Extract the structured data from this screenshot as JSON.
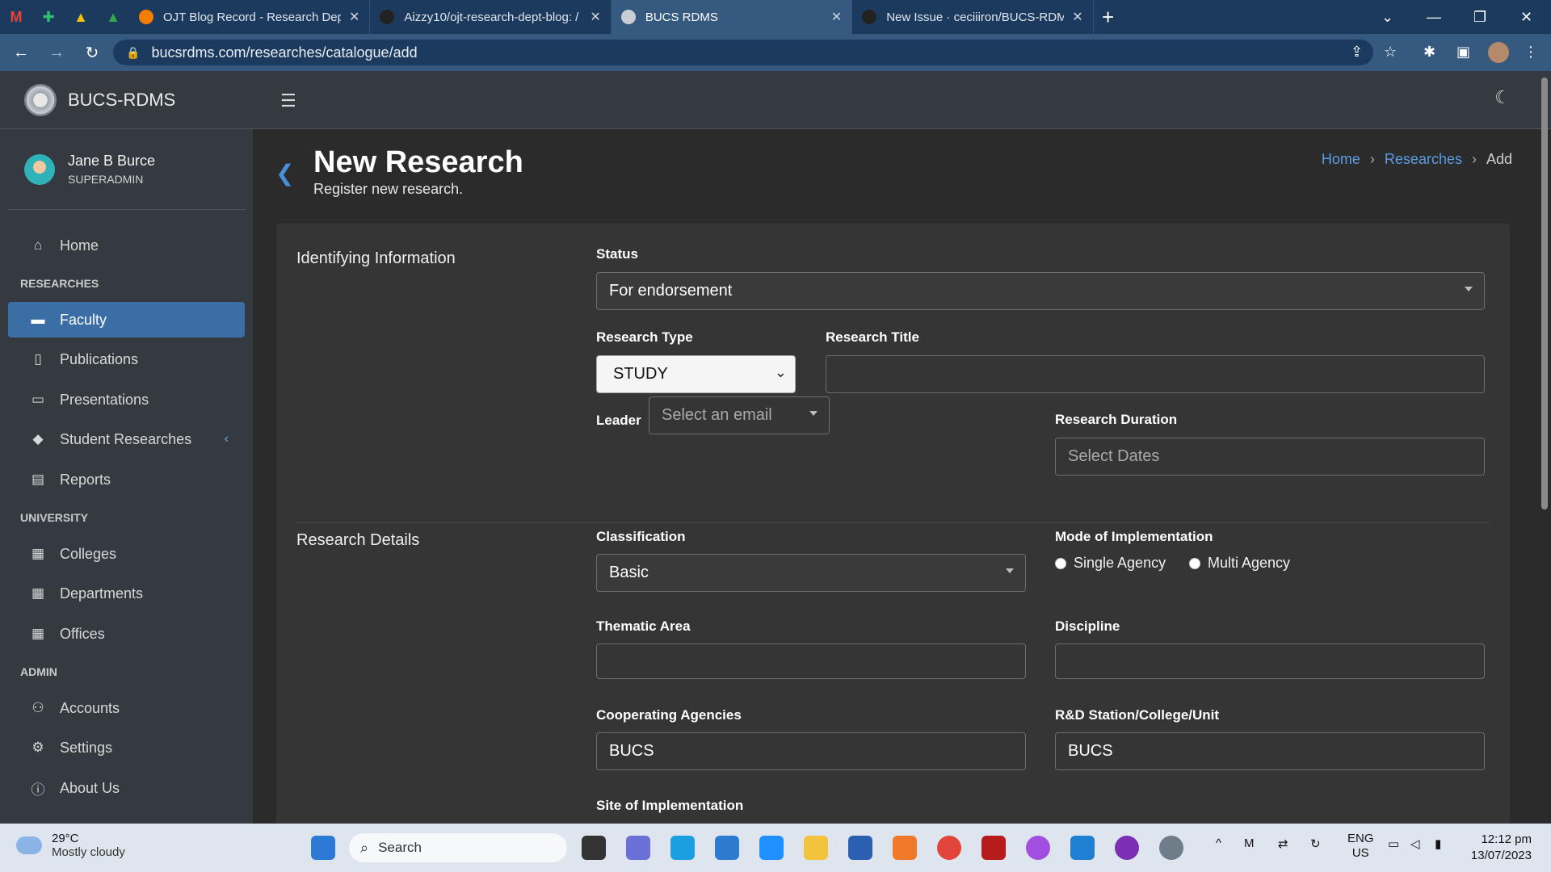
{
  "browser": {
    "tabs": [
      {
        "title": "OJT Blog Record - Research Depa",
        "active": false
      },
      {
        "title": "Aizzy10/ojt-research-dept-blog: /",
        "active": false
      },
      {
        "title": "BUCS RDMS",
        "active": true
      },
      {
        "title": "New Issue · ceciiiron/BUCS-RDMS",
        "active": false
      }
    ],
    "url": "bucsrdms.com/researches/catalogue/add"
  },
  "app": {
    "brand": "BUCS-RDMS",
    "user": {
      "name": "Jane B Burce",
      "role": "SUPERADMIN"
    },
    "nav": {
      "home": "Home",
      "researches_header": "RESEARCHES",
      "faculty": "Faculty",
      "publications": "Publications",
      "presentations": "Presentations",
      "student_researches": "Student Researches",
      "reports": "Reports",
      "university_header": "UNIVERSITY",
      "colleges": "Colleges",
      "departments": "Departments",
      "offices": "Offices",
      "admin_header": "ADMIN",
      "accounts": "Accounts",
      "settings": "Settings",
      "about": "About Us"
    }
  },
  "page": {
    "title": "New Research",
    "subtitle": "Register new research.",
    "breadcrumb": {
      "home": "Home",
      "researches": "Researches",
      "current": "Add"
    }
  },
  "form": {
    "identifying_section": "Identifying Information",
    "status_label": "Status",
    "status_value": "For endorsement",
    "research_type_label": "Research Type",
    "research_type_value": "STUDY",
    "research_title_label": "Research Title",
    "research_title_value": "",
    "leader_label": "Leader",
    "leader_placeholder": "Select an email",
    "duration_label": "Research Duration",
    "duration_placeholder": "Select Dates",
    "details_section": "Research Details",
    "classification_label": "Classification",
    "classification_value": "Basic",
    "mode_label": "Mode of Implementation",
    "mode_single": "Single Agency",
    "mode_multi": "Multi Agency",
    "thematic_label": "Thematic Area",
    "thematic_value": "",
    "discipline_label": "Discipline",
    "discipline_value": "",
    "cooperating_label": "Cooperating Agencies",
    "cooperating_value": "BUCS",
    "station_label": "R&D Station/College/Unit",
    "station_value": "BUCS",
    "site_label": "Site of Implementation"
  },
  "taskbar": {
    "temperature": "29°C",
    "weather": "Mostly cloudy",
    "search_label": "Search",
    "lang": "ENG",
    "region": "US",
    "time": "12:12 pm",
    "date": "13/07/2023"
  }
}
